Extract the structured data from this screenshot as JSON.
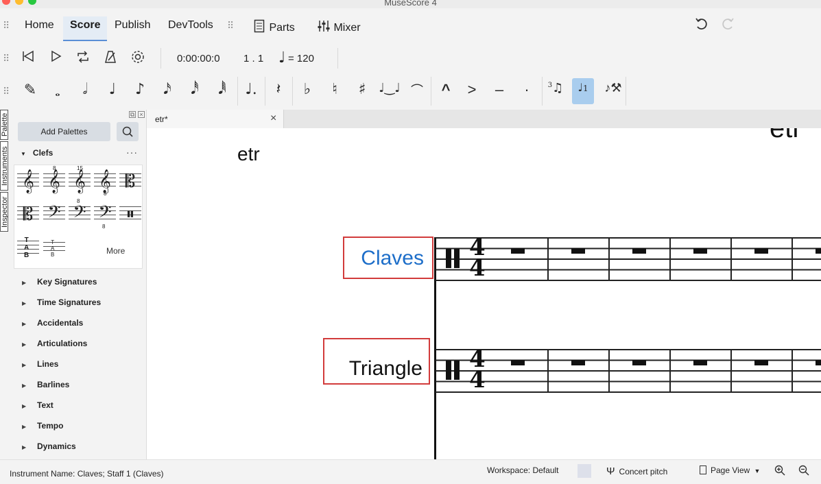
{
  "window": {
    "title": "MuseScore 4"
  },
  "menubar": {
    "tabs": [
      "Home",
      "Score",
      "Publish",
      "DevTools"
    ],
    "active_tab": "Score",
    "parts_label": "Parts",
    "mixer_label": "Mixer"
  },
  "playback": {
    "time": "0:00:00:0",
    "position": "1 . 1",
    "tempo": "= 120"
  },
  "note_input": {
    "icons": [
      "pencil-icon",
      "whole-note-icon",
      "half-note-icon",
      "quarter-note-icon",
      "eighth-note-icon",
      "sixteenth-note-icon",
      "32nd-note-icon",
      "64th-note-icon",
      "augmentation-dot-icon",
      "rest-icon",
      "flat-icon",
      "natural-icon",
      "sharp-icon",
      "tie-icon",
      "slur-icon",
      "marcato-icon",
      "accent-icon",
      "tenuto-icon",
      "staccato-icon",
      "tuplet-icon",
      "voice-1-icon",
      "customize-toolbar-icon"
    ],
    "active": "voice-1-icon",
    "voice_label": "1",
    "tuplet_label": "3"
  },
  "sidetabs": [
    "Palette",
    "Instruments",
    "Inspector"
  ],
  "palette": {
    "add_label": "Add Palettes",
    "clefs": {
      "title": "Clefs",
      "more_label": "More",
      "more_dots": "···",
      "glyph_labels": [
        "8",
        "15"
      ]
    },
    "categories": [
      "Key Signatures",
      "Time Signatures",
      "Accidentals",
      "Articulations",
      "Lines",
      "Barlines",
      "Text",
      "Tempo",
      "Dynamics"
    ]
  },
  "score": {
    "tab_label": "etr*",
    "title": "etr",
    "instruments": [
      "Claves",
      "Triangle"
    ],
    "time_signature": {
      "top": "4",
      "bottom": "4"
    },
    "measures_visible": 6
  },
  "status": {
    "selection": "Instrument Name: Claves; Staff 1 (Claves)",
    "workspace": "Workspace: Default",
    "concert_pitch": "Concert pitch",
    "view_mode": "Page View"
  },
  "colors": {
    "accent": "#5a8ed6",
    "active_button": "#a9cdee",
    "selection_box": "#d23b3b",
    "selected_instrument_text": "#1d6ec9"
  }
}
